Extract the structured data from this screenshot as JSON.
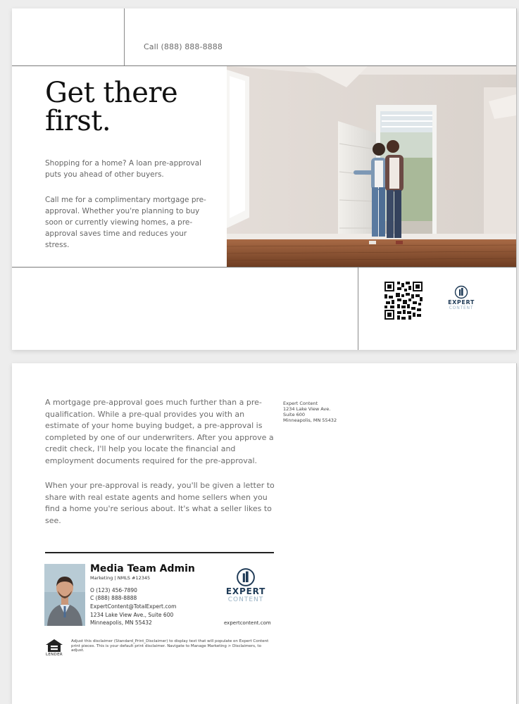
{
  "header": {
    "phone": "Call (888) 888-8888"
  },
  "hero": {
    "headline_line1": "Get there",
    "headline_line2": "first.",
    "para1": "Shopping for a home? A loan pre-approval puts you ahead of other buyers.",
    "para2": "Call me for a complimentary mortgage pre-approval. Whether you're planning to buy soon or currently viewing homes, a pre-approval saves time and reduces your stress."
  },
  "brand": {
    "name_line1": "EXPERT",
    "name_line2": "CONTENT",
    "color_dark": "#1f3b57",
    "color_light": "#9ab3c5"
  },
  "back": {
    "para1": "A mortgage pre-approval goes much further than a pre-qualification. While a pre-qual provides you with an estimate of your home buying budget, a pre-approval is completed by one of our underwriters. After you approve a credit check, I'll help you locate the financial and employment documents required for the pre-approval.",
    "para2": "When your pre-approval is ready, you'll be given a letter to share with real estate agents and home sellers when you find a home you're serious about. It's what a seller likes to see."
  },
  "return_address": {
    "line1": "Expert Content",
    "line2": "1234 Lake View Ave.",
    "line3": "Suite 600",
    "line4": "Minneapolis, MN 55432"
  },
  "agent": {
    "name": "Media Team Admin",
    "title": "Marketing | NMLS #12345",
    "office": "O (123) 456-7890",
    "cell": "C (888) 888-8888",
    "email": "ExpertContent@TotalExpert.com",
    "addr1": "1234 Lake View Ave., Suite 600",
    "addr2": "Minneapolis, MN 55432",
    "website": "expertcontent.com"
  },
  "disclaimer": "Adjust this disclaimer (Standard_Print_Disclaimer) to display text that will populate on Expert Content print pieces. This is your default print disclaimer. Navigate to Manage Marketing > Disclaimers, to adjust.",
  "ehl_label": "LENDER"
}
